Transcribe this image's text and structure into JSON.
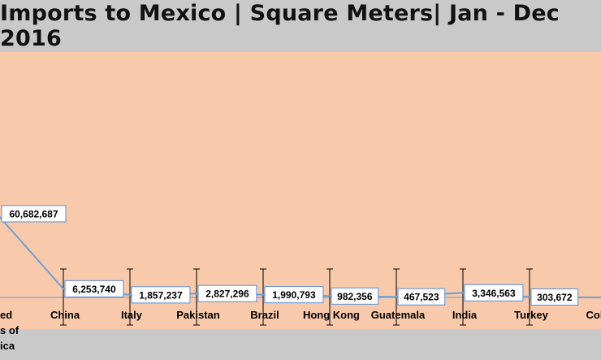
{
  "chart_data": {
    "type": "line",
    "title": "Imports to Mexico | Square Meters| Jan - Dec 2016",
    "categories": [
      [
        "ed",
        "s of",
        "ica"
      ],
      [
        "China"
      ],
      [
        "Italy"
      ],
      [
        "Pakistan"
      ],
      [
        "Brazil"
      ],
      [
        "Hong Kong"
      ],
      [
        "Guatemala"
      ],
      [
        "India"
      ],
      [
        "Turkey"
      ],
      [
        "Colo"
      ]
    ],
    "values": [
      60682687,
      6253740,
      1857237,
      2827296,
      1990793,
      982356,
      467523,
      3346563,
      303672,
      null
    ],
    "labels": [
      "60,682,687",
      "6,253,740",
      "1,857,237",
      "2,827,296",
      "1,990,793",
      "982,356",
      "467,523",
      "3,346,563",
      "303,672",
      ""
    ],
    "ylim": [
      0,
      80000000
    ],
    "grid": false,
    "error_bars": true,
    "colors": {
      "plot_background": "#f8c9aa",
      "page_background": "#c9c9c9",
      "line": "#6f9fd2",
      "axis": "#8aa4c8",
      "error_bar": "#000000",
      "label_box_border": "#5b8fd0"
    }
  }
}
